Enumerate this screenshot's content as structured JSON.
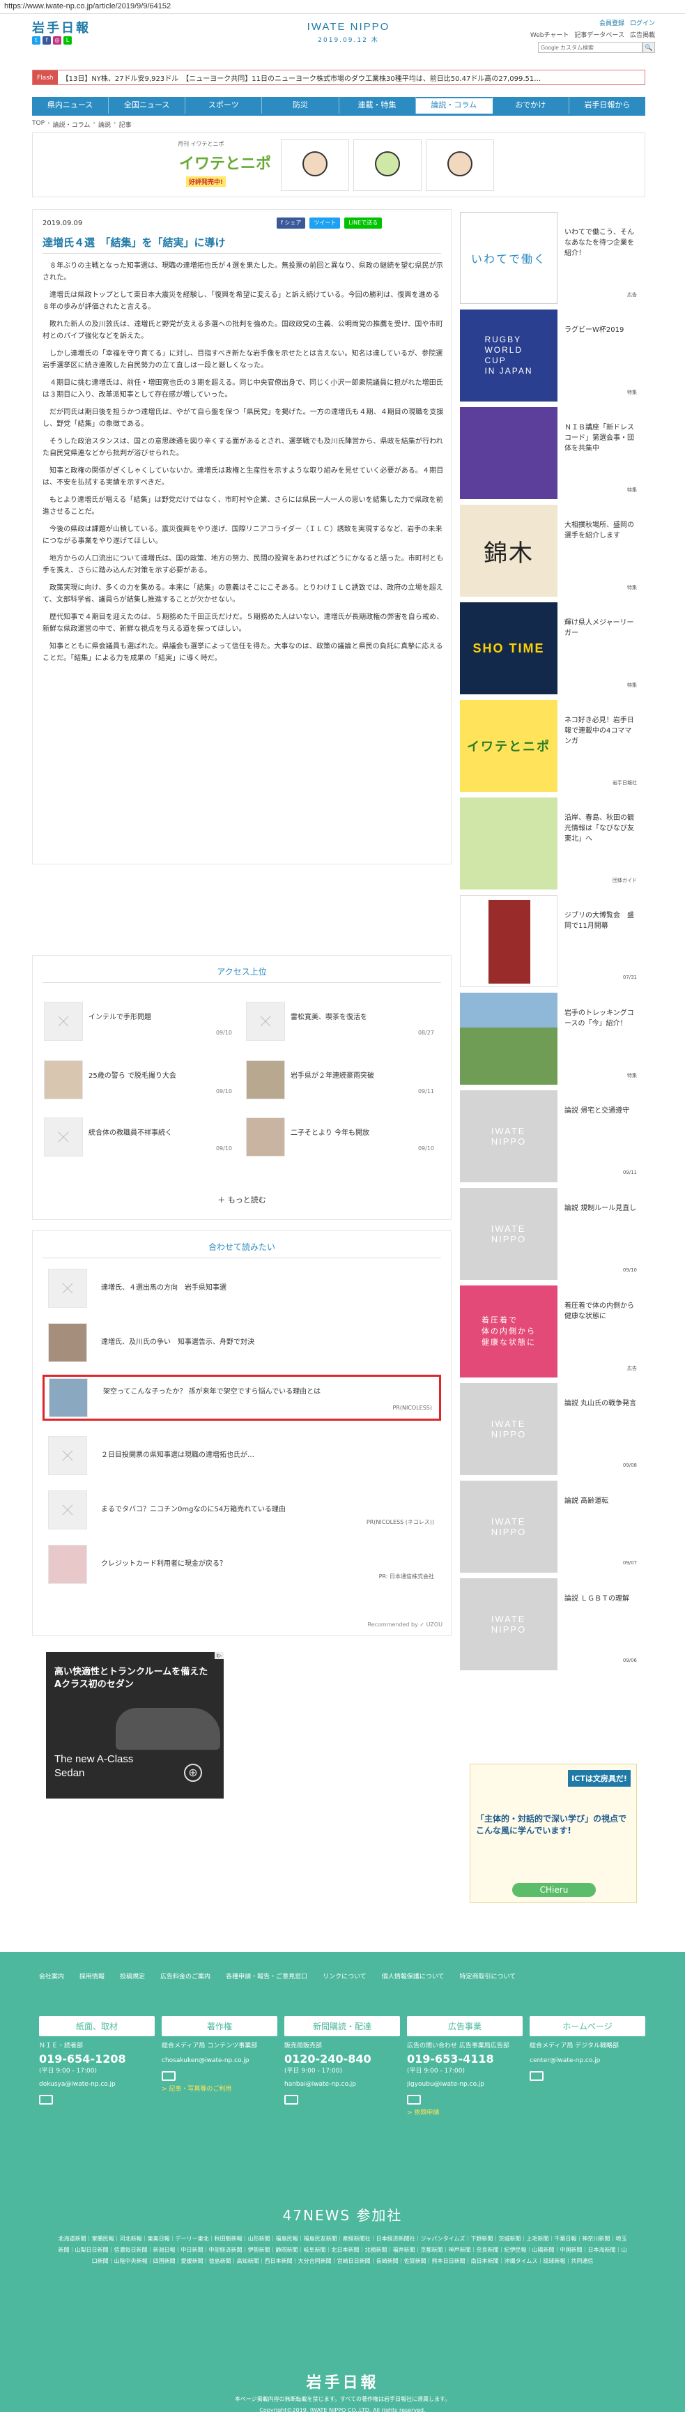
{
  "url": "https://www.iwate-np.co.jp/article/2019/9/9/64152",
  "header": {
    "logo_text": "岩手日報",
    "center_logo": "IWATE NIPPO",
    "center_date": "2019.09.12 木",
    "login_links": [
      "会員登録",
      "ログイン"
    ],
    "util_links": [
      "Webチャート",
      "記事データベース",
      "広告掲載"
    ],
    "search_placeholder": "Google カスタム検索",
    "search_button": "🔍",
    "social_icons": [
      "twitter-icon",
      "facebook-icon",
      "instagram-icon",
      "line-icon"
    ]
  },
  "ticker": {
    "label": "Flash",
    "text": "【13日】NY株、27ドル安9,923ドル　【ニューヨーク共同】11日のニューヨーク株式市場のダウ工業株30種平均は、前日比50.47ドル高の27,099.51…"
  },
  "nav": {
    "items": [
      "県内ニュース",
      "全国ニュース",
      "スポーツ",
      "防災",
      "連載・特集",
      "論説・コラム",
      "おでかけ",
      "岩手日報から"
    ],
    "active_index": 5
  },
  "breadcrumb": [
    "TOP",
    "論説・コラム",
    "論説",
    "記事"
  ],
  "banner": {
    "subtitle": "月刊 イワテとニポ",
    "main": "イワテとニポ",
    "badge": "好評発売中!"
  },
  "article": {
    "date": "2019.09.09",
    "share": [
      "f シェア",
      "ツイート",
      "LINEで送る"
    ],
    "title": "達増氏４選　「結集」を「結実」に導け",
    "paragraphs": [
      "８年ぶりの主戦となった知事選は、現職の達増拓也氏が４選を果たした。無投票の前回と異なり、県政の継続を望む県民が示された。",
      "達増氏は県政トップとして東日本大震災を経験し、「復興を希望に変える」と訴え続けている。今回の勝利は、復興を進める８年の歩みが評価されたと言える。",
      "敗れた新人の及川敦氏は、達増氏と野党が支える多選への批判を強めた。国政政党の主義、公明両党の推薦を受け、国や市町村とのパイプ強化などを訴えた。",
      "しかし達増氏の「幸福を守り育てる」に対し、目指すべき新たな岩手像を示せたとは言えない。知名は達しているが、参院選岩手選挙区に続き連敗した自民勢力の立て直しは一段と厳しくなった。",
      "４期目に挑む達増氏は、前任・増田寛也氏の３期を超える。同じ中央官僚出身で、同じく小沢一郎衆院議員に担がれた増田氏は３期目に入り、改革派知事として存在感が増していった。",
      "だが同氏は期日後を担うかつ達増氏は、やがて自ら盤を保つ「県民党」を掲げた。一方の達増氏も４期、４期目の現職を支援し、野党「結集」の象徴である。",
      "そうした政治スタンスは、国との意思疎通を図り辛くする面があるとされ、選挙戦でも及川氏陣営から、県政を結集が行われた自民党県連などから批判が浴びせられた。",
      "知事と政権の関係がぎくしゃくしていないか。達増氏は政権と生産性を示すような取り組みを見せていく必要がある。４期目は、不安を払拭する実績を示すべきだ。",
      "もとより達増氏が唱える「結集」は野党だけではなく、市町村や企業、さらには県民一人一人の思いを結集した力で県政を前進させることだ。",
      "今後の県政は課題が山積している。震災復興をやり遂げ、国際リニアコライダー（ＩＬＣ）誘致を実現するなど、岩手の未来につながる事業をやり遂げてほしい。",
      "地方からの人口流出について達増氏は、国の政策、地方の努力、民間の投資をあわせればどうにかなると語った。市町村とも手を携え、さらに踏み込んだ対策を示す必要がある。",
      "政策実現に向け、多くの力を集める。本来に「結集」の意義はそこにこそある。とりわけＩＬＣ誘致では、政府の立場を超えて、文部科学省、議員らが結集し推進することが欠かせない。",
      "歴代知事で４期目を迎えたのは、５期務めた千田正氏だけだ。５期務めた人はいない。達増氏が長期政権の弊害を自ら戒め、新鮮な県政運営の中で、新鮮な視点を与える道を探ってほしい。",
      "知事とともに県会議員も選ばれた。県議会も選挙によって信任を得た。大事なのは、政策の議論と県民の負託に真摯に応えることだ。「結集」による力を成果の「結実」に導く時だ。"
    ]
  },
  "access_ranking": {
    "title": "アクセス上位",
    "items": [
      {
        "title": "インテルで手形問題",
        "date": "09/10"
      },
      {
        "title": "雷松寛美、喫茶を復活を",
        "date": "08/27"
      },
      {
        "title": "25歳の警ら で脱毛撮り大会",
        "date": "09/10"
      },
      {
        "title": "岩手県が２年連続豪雨突破",
        "date": "09/11"
      },
      {
        "title": "統合体の教職員不祥事続く",
        "date": "09/10"
      },
      {
        "title": "二子そとより 今年も開放",
        "date": "09/10"
      }
    ],
    "more": "＋ もっと読む"
  },
  "related": {
    "title": "合わせて読みたい",
    "items": [
      {
        "title": "達増氏、４選出馬の方向　岩手県知事選",
        "source": ""
      },
      {
        "title": "達増氏、及川氏の争い　知事選告示、舟野で対決",
        "source": ""
      },
      {
        "title": "架空ってこんな子ったか？ 孫が来年で架空ですら悩んでいる理由とは",
        "source": "PR(NICOLESS)"
      },
      {
        "title": "２日目投開票の県知事選は現職の達増拓也氏が…",
        "source": ""
      },
      {
        "title": "まるでタバコ？ニコチン0mgなのに54万箱売れている理由",
        "source": "PR(NICOLESS (ネコレス))"
      },
      {
        "title": "クレジットカード利用者に現金が戻る？",
        "source": "PR: 日本通信株式会社"
      }
    ],
    "recommend": "Recommended by ✓ UZOU"
  },
  "bigad": {
    "headline": "高い快適性とトランクルームを備えたAクラス初のセダン",
    "name": "The new A-Class Sedan",
    "logo": "⊕",
    "tag": "i▷"
  },
  "sidebar": {
    "items": [
      {
        "title": "いわてで働こう、そんなあなたを待つ企業を紹介！",
        "tag": "広告",
        "img": "iwate-work"
      },
      {
        "title": "ラグビーW杯2019",
        "tag": "特集",
        "img": "rugby"
      },
      {
        "title": "ＮＩＢ講座「新ドレスコード」第選会事・団体を共集中",
        "tag": "特集",
        "img": "nib"
      },
      {
        "title": "大相撲秋場所、盛岡の選手を紹介します",
        "tag": "特集",
        "img": "sumo"
      },
      {
        "title": "輝け県人メジャーリーガー",
        "tag": "特集",
        "img": "shotime"
      },
      {
        "title": "ネコ好き必見！岩手日報で連載中の4コママンガ",
        "tag": "岩手日報社",
        "img": "neko"
      },
      {
        "title": "沿岸、春島、秋田の観光情報は「なびなび友東北」へ",
        "tag": "団体ガイド",
        "img": "map"
      },
      {
        "title": "ジブリの大博覧会　盛岡で11月開幕",
        "tag": "07/31",
        "img": "ghibli"
      },
      {
        "title": "岩手のトレッキングコースの「今」紹介！",
        "tag": "特集",
        "img": "mountain"
      },
      {
        "title": "論説 帰宅と交通遵守",
        "tag": "09/11",
        "img": "iwate-logo"
      },
      {
        "title": "論説 規制ルール見直し",
        "tag": "09/10",
        "img": "iwate-logo"
      },
      {
        "title": "着圧着で体の内側から健康な状態に",
        "tag": "広告",
        "img": "health"
      },
      {
        "title": "論説 丸山氏の戦争発言",
        "tag": "09/08",
        "img": "iwate-logo"
      },
      {
        "title": "論説 高齢運転",
        "tag": "09/07",
        "img": "iwate-logo"
      },
      {
        "title": "論説 ＬＧＢＴの理解",
        "tag": "09/06",
        "img": "iwate-logo"
      }
    ],
    "ict_ad": {
      "title": "ICTは文房具だ!",
      "body": "「主体的・対話的で深い学び」の視点でこんな風に学んでいます!",
      "brand": "CHieru"
    }
  },
  "footer": {
    "links": [
      "会社案内",
      "採用情報",
      "投稿規定",
      "広告料金のご案内",
      "各種申請・報告・ご意見窓口",
      "リンクについて",
      "個人情報保護について",
      "特定商取引について"
    ],
    "columns": [
      {
        "head": "紙面、取材",
        "desc": "ＮＩＥ・読者部",
        "tel": "019-654-1208",
        "hours": "(平日 9:00 - 17:00)",
        "mail": "dokusya@iwate-np.co.jp",
        "extra": ""
      },
      {
        "head": "著作権",
        "desc": "総合メディア局 コンテンツ事業部",
        "tel": "",
        "hours": "",
        "mail": "chosakuken@iwate-np.co.jp",
        "extra": "> 記事・写真等のご利用"
      },
      {
        "head": "新聞購読・配達",
        "desc": "販売局販売部",
        "tel": "0120-240-840",
        "hours": "(平日 9:00 - 17:00)",
        "mail": "hanbai@iwate-np.co.jp",
        "extra": ""
      },
      {
        "head": "広告事業",
        "desc": "広告の問い合わせ 広告事業局広告部",
        "tel": "019-653-4118",
        "hours": "(平日 9:00 - 17:00)",
        "mail": "jigyoubu@iwate-np.co.jp",
        "extra": "> 依頼申請"
      },
      {
        "head": "ホームページ",
        "desc": "総合メディア局 デジタル戦略部",
        "tel": "",
        "hours": "",
        "mail": "center@iwate-np.co.jp",
        "extra": ""
      }
    ],
    "n47_title": "47NEWS 参加社",
    "n47_members": "北海道新聞｜室蘭民報｜河北新報｜東奥日報｜デーリー東北｜秋田魁新報｜山形新聞｜福島民報｜福島民友新聞｜産経新聞社｜日本経済新聞社｜ジャパンタイムズ｜下野新聞｜茨城新聞｜上毛新聞｜千葉日報｜神奈川新聞｜埼玉新聞｜山梨日日新聞｜信濃毎日新聞｜新潟日報｜中日新聞｜中部経済新聞｜伊勢新聞｜静岡新聞｜岐阜新聞｜北日本新聞｜北國新聞｜福井新聞｜京都新聞｜神戸新聞｜奈良新聞｜紀伊民報｜山陽新聞｜中国新聞｜日本海新聞｜山口新聞｜山陰中央新報｜四国新聞｜愛媛新聞｜徳島新聞｜高知新聞｜西日本新聞｜大分合同新聞｜宮崎日日新聞｜長崎新聞｜佐賀新聞｜熊本日日新聞｜南日本新聞｜沖縄タイムス｜琉球新報｜共同通信",
    "logo": "岩手日報",
    "copy": "本ページ掲載内容の無断転載を禁じます。すべての著作権は岩手日報社に帰属します。",
    "copyright": "Copyright©2019, IWATE NIPPO CO.,LTD. All rights reserved."
  },
  "colors": {
    "brand": "#2c8cc2",
    "footer": "#4db89e",
    "title": "#1f7aa8",
    "highlight": "#e0252a"
  }
}
